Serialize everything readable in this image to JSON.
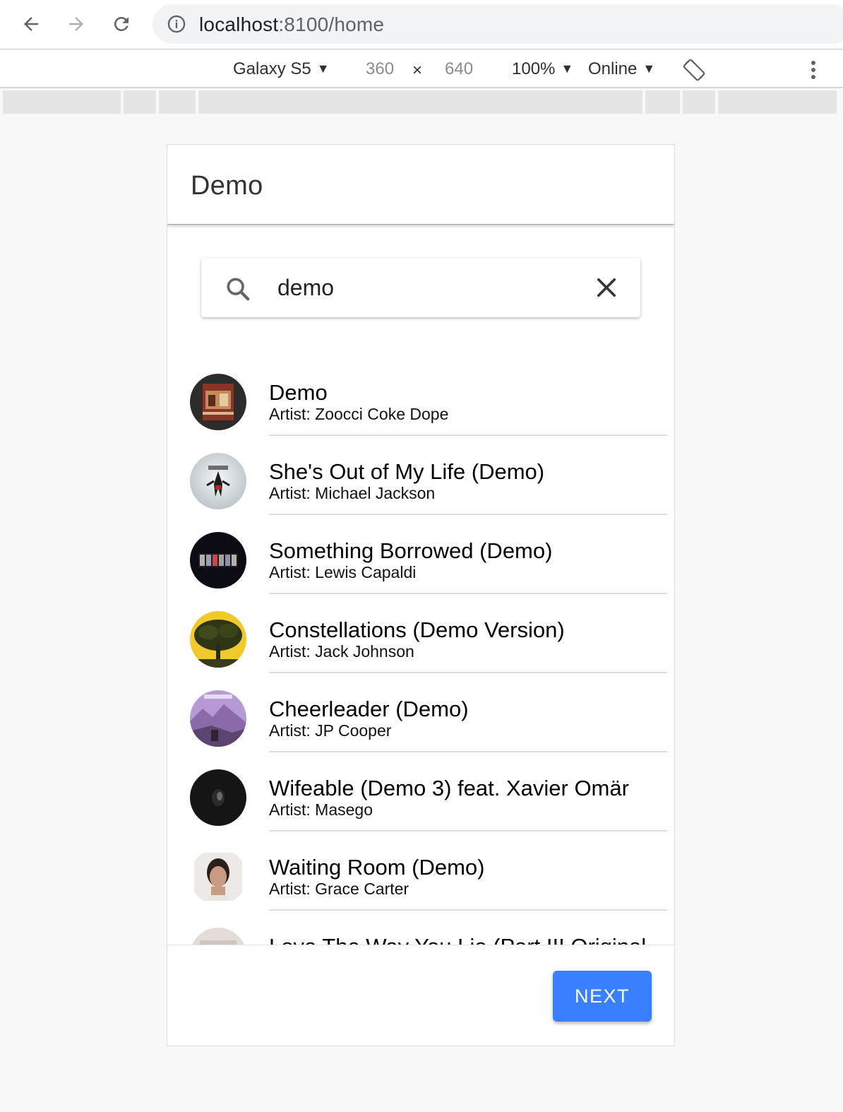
{
  "browser": {
    "url_host": "localhost",
    "url_path": ":8100/home"
  },
  "device_toolbar": {
    "device": "Galaxy S5",
    "width": "360",
    "times": "×",
    "height": "640",
    "zoom": "100%",
    "network": "Online"
  },
  "app": {
    "title": "Demo",
    "search": {
      "value": "demo"
    },
    "results": [
      {
        "title": "Demo",
        "artist": "Artist: Zoocci Coke Dope",
        "icon": "album-art-dark"
      },
      {
        "title": "She's Out of My Life (Demo)",
        "artist": "Artist: Michael Jackson",
        "icon": "album-art-this-is-it"
      },
      {
        "title": "Something Borrowed (Demo)",
        "artist": "Artist: Lewis Capaldi",
        "icon": "album-art-breach"
      },
      {
        "title": "Constellations (Demo Version)",
        "artist": "Artist: Jack Johnson",
        "icon": "album-art-tree"
      },
      {
        "title": "Cheerleader (Demo)",
        "artist": "Artist: JP Cooper",
        "icon": "album-art-purple"
      },
      {
        "title": "Wifeable (Demo 3) feat. Xavier Omär",
        "artist": "Artist: Masego",
        "icon": "album-art-black"
      },
      {
        "title": "Waiting Room (Demo)",
        "artist": "Artist: Grace Carter",
        "icon": "album-art-portrait"
      },
      {
        "title": "Love The Way You Lie (Part III Original",
        "artist": "",
        "icon": "album-art-light"
      }
    ],
    "next_label": "NEXT"
  },
  "colors": {
    "primary_button": "#3880ff"
  }
}
